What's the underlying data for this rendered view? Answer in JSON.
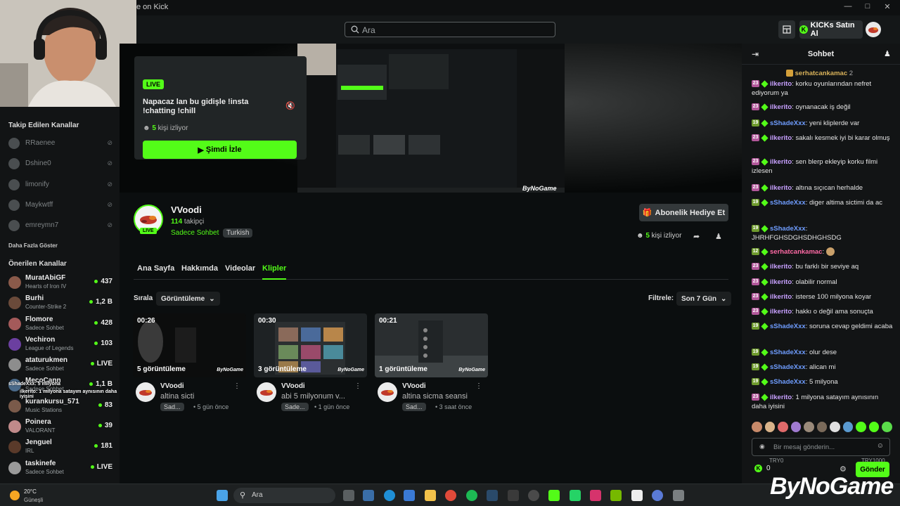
{
  "window": {
    "title": "e on Kick"
  },
  "search": {
    "placeholder": "Ara"
  },
  "header": {
    "kicks_button": "KICKs Satın Al"
  },
  "sidebar": {
    "followed_title": "Takip Edilen Kanallar",
    "followed": [
      "RRaenee",
      "Dshine0",
      "limonify",
      "Maykwtff",
      "emreymn7"
    ],
    "show_more": "Daha Fazla Göster",
    "recommended_title": "Önerilen Kanallar",
    "recommended": [
      {
        "name": "MuratAbiGF",
        "game": "Hearts of Iron IV",
        "viewers": "437"
      },
      {
        "name": "Burhi",
        "game": "Counter-Strike 2",
        "viewers": "1,2 B"
      },
      {
        "name": "Flomore",
        "game": "Sadece Sohbet",
        "viewers": "428"
      },
      {
        "name": "Vechiron",
        "game": "League of Legends",
        "viewers": "103"
      },
      {
        "name": "ataturukmen",
        "game": "Sadece Sohbet",
        "viewers": "LIVE"
      },
      {
        "name": "MecoCann",
        "game": "Sadece Sohbet",
        "viewers": "1,1 B"
      },
      {
        "name": "kurankursu_571",
        "game": "Music Stations",
        "viewers": "83"
      },
      {
        "name": "Poinera",
        "game": "VALORANT",
        "viewers": "39"
      },
      {
        "name": "Jenguel",
        "game": "IRL",
        "viewers": "181"
      },
      {
        "name": "taskinefe",
        "game": "Sadece Sohbet",
        "viewers": "LIVE"
      }
    ],
    "overlay_line1": "sShadeXxx: 5 milyona",
    "overlay_line2": "ilkerito: 1 milyona satayım aynısının daha iyisini"
  },
  "player": {
    "live_badge": "LIVE",
    "stream_title": "Napacaz lan bu gidişle !insta !chatting !chill",
    "viewers_count": "5",
    "viewers_suffix": "kişi izliyor",
    "watch_button": "Şimdi İzle",
    "watermark": "ByNoGame"
  },
  "channel": {
    "name": "VVoodi",
    "live_badge": "LIVE",
    "followers_count": "114",
    "followers_suffix": "takipçi",
    "category": "Sadece Sohbet",
    "tag": "Turkish",
    "gift_button": "Abonelik Hediye Et",
    "viewers_count": "5",
    "viewers_suffix": "kişi izliyor"
  },
  "tabs": [
    "Ana Sayfa",
    "Hakkımda",
    "Videolar",
    "Klipler"
  ],
  "clips_toolbar": {
    "sort_label": "Sırala",
    "sort_value": "Görüntüleme",
    "filter_label": "Filtrele:",
    "filter_value": "Son 7 Gün"
  },
  "clips": [
    {
      "duration": "00:26",
      "views": "5 görüntüleme",
      "channel": "VVoodi",
      "title": "altina sicti",
      "category": "Sad...",
      "ago": "5 gün önce"
    },
    {
      "duration": "00:30",
      "views": "3 görüntüleme",
      "channel": "VVoodi",
      "title": "abi 5 milyonum v...",
      "category": "Sade...",
      "ago": "1 gün önce"
    },
    {
      "duration": "00:21",
      "views": "1 görüntüleme",
      "channel": "VVoodi",
      "title": "altina sicma seansi",
      "category": "Sad...",
      "ago": "3 saat önce"
    }
  ],
  "chat": {
    "title": "Sohbet",
    "pinned_user": "serhatcankamac",
    "pinned_count": "2",
    "messages": [
      {
        "badge": "23",
        "user": "ilkerito",
        "text": "korku oyunlarından nefret ediyorum ya",
        "color": "c-ilk",
        "bt": "p"
      },
      {
        "badge": "23",
        "user": "ilkerito",
        "text": "oynanacak iş değil",
        "color": "c-ilk",
        "bt": "p"
      },
      {
        "badge": "19",
        "user": "sShadeXxx",
        "text": "yeni kliplerde var",
        "color": "c-sha",
        "bt": "g"
      },
      {
        "badge": "23",
        "user": "ilkerito",
        "text": "sakalı kesmek iyi bi karar olmuş",
        "color": "c-ilk",
        "bt": "p"
      },
      {
        "badge": "23",
        "user": "ilkerito",
        "text": "sen blerp ekleyip korku filmi izlesen",
        "color": "c-ilk",
        "bt": "p"
      },
      {
        "badge": "23",
        "user": "ilkerito",
        "text": "altına sıçıcan herhalde",
        "color": "c-ilk",
        "bt": "p"
      },
      {
        "badge": "19",
        "user": "sShadeXxx",
        "text": "diger altima sictimi da ac",
        "color": "c-sha",
        "bt": "g"
      },
      {
        "badge": "19",
        "user": "sShadeXxx",
        "text": "JHRHFGHSDGHSDHGHSDG",
        "color": "c-sha",
        "bt": "g"
      },
      {
        "badge": "12",
        "user": "serhatcankamac",
        "text": "",
        "color": "c-ser",
        "bt": "g"
      },
      {
        "badge": "23",
        "user": "ilkerito",
        "text": "bu farklı bir seviye aq",
        "color": "c-ilk",
        "bt": "p"
      },
      {
        "badge": "23",
        "user": "ilkerito",
        "text": "olabilir normal",
        "color": "c-ilk",
        "bt": "p"
      },
      {
        "badge": "23",
        "user": "ilkerito",
        "text": "isterse 100 milyona koyar",
        "color": "c-ilk",
        "bt": "p"
      },
      {
        "badge": "23",
        "user": "ilkerito",
        "text": "hakkı o değil ama sonuçta",
        "color": "c-ilk",
        "bt": "p"
      },
      {
        "badge": "19",
        "user": "sShadeXxx",
        "text": "soruna cevap geldimi acaba",
        "color": "c-sha",
        "bt": "g"
      },
      {
        "badge": "19",
        "user": "sShadeXxx",
        "text": "olur dese",
        "color": "c-sha",
        "bt": "g"
      },
      {
        "badge": "19",
        "user": "sShadeXxx",
        "text": "alican mi",
        "color": "c-sha",
        "bt": "g"
      },
      {
        "badge": "19",
        "user": "sShadeXxx",
        "text": "5 milyona",
        "color": "c-sha",
        "bt": "g"
      },
      {
        "badge": "23",
        "user": "ilkerito",
        "text": "1 milyona satayım aynısının daha iyisini",
        "color": "c-ilk",
        "bt": "p"
      }
    ],
    "input_placeholder": "Bir mesaj gönderin...",
    "send_button": "Gönder",
    "kicks_balance": "0",
    "try_left": "TRY0",
    "try_right": "TRY1000"
  },
  "taskbar": {
    "temperature": "20°C",
    "condition": "Güneşli",
    "search_placeholder": "Ara"
  },
  "overlay_watermark": "ByNoGame",
  "colors": {
    "accent": "#53fc18",
    "bg": "#0b0e0f",
    "panel": "#121415"
  }
}
